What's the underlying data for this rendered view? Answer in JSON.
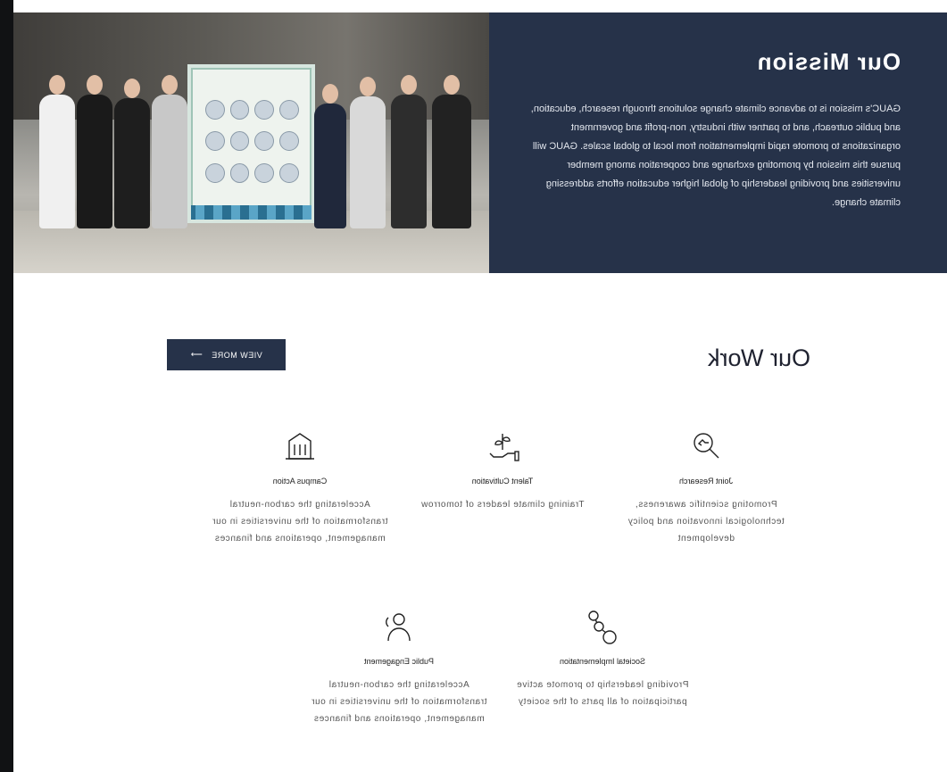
{
  "mission": {
    "title": "Our Mission",
    "body": "GAUC's mission is to advance climate change solutions through research, education, and public outreach, and to partner with industry, non-profit and government organizations to promote rapid implementation from local to global scales. GAUC will pursue this mission by promoting exchange and cooperation among member universities and providing leadership of global higher education efforts addressing climate change."
  },
  "work": {
    "title": "Our Work",
    "view_more": "VIEW MORE",
    "arrow": "⟶",
    "items": [
      {
        "icon": "research-icon",
        "title": "Joint Research",
        "desc": "Promoting scientific awareness, technological innovation and policy development"
      },
      {
        "icon": "plant-hand-icon",
        "title": "Talent Cultivation",
        "desc": "Training climate leaders of tomorrow"
      },
      {
        "icon": "building-icon",
        "title": "Campus Action",
        "desc": "Accelerating the carbon-neutral transformation of the universities in our management, operations and finances"
      },
      {
        "icon": "network-people-icon",
        "title": "Societal Implementation",
        "desc": "Providing leadership to promote active participation of all parts of the society"
      },
      {
        "icon": "people-icon",
        "title": "Public Engagement",
        "desc": "Accelerating the carbon-neutral transformation of the universities in our management, operations and finances"
      }
    ]
  },
  "colors": {
    "navy": "#263249",
    "frame": "#111214"
  }
}
